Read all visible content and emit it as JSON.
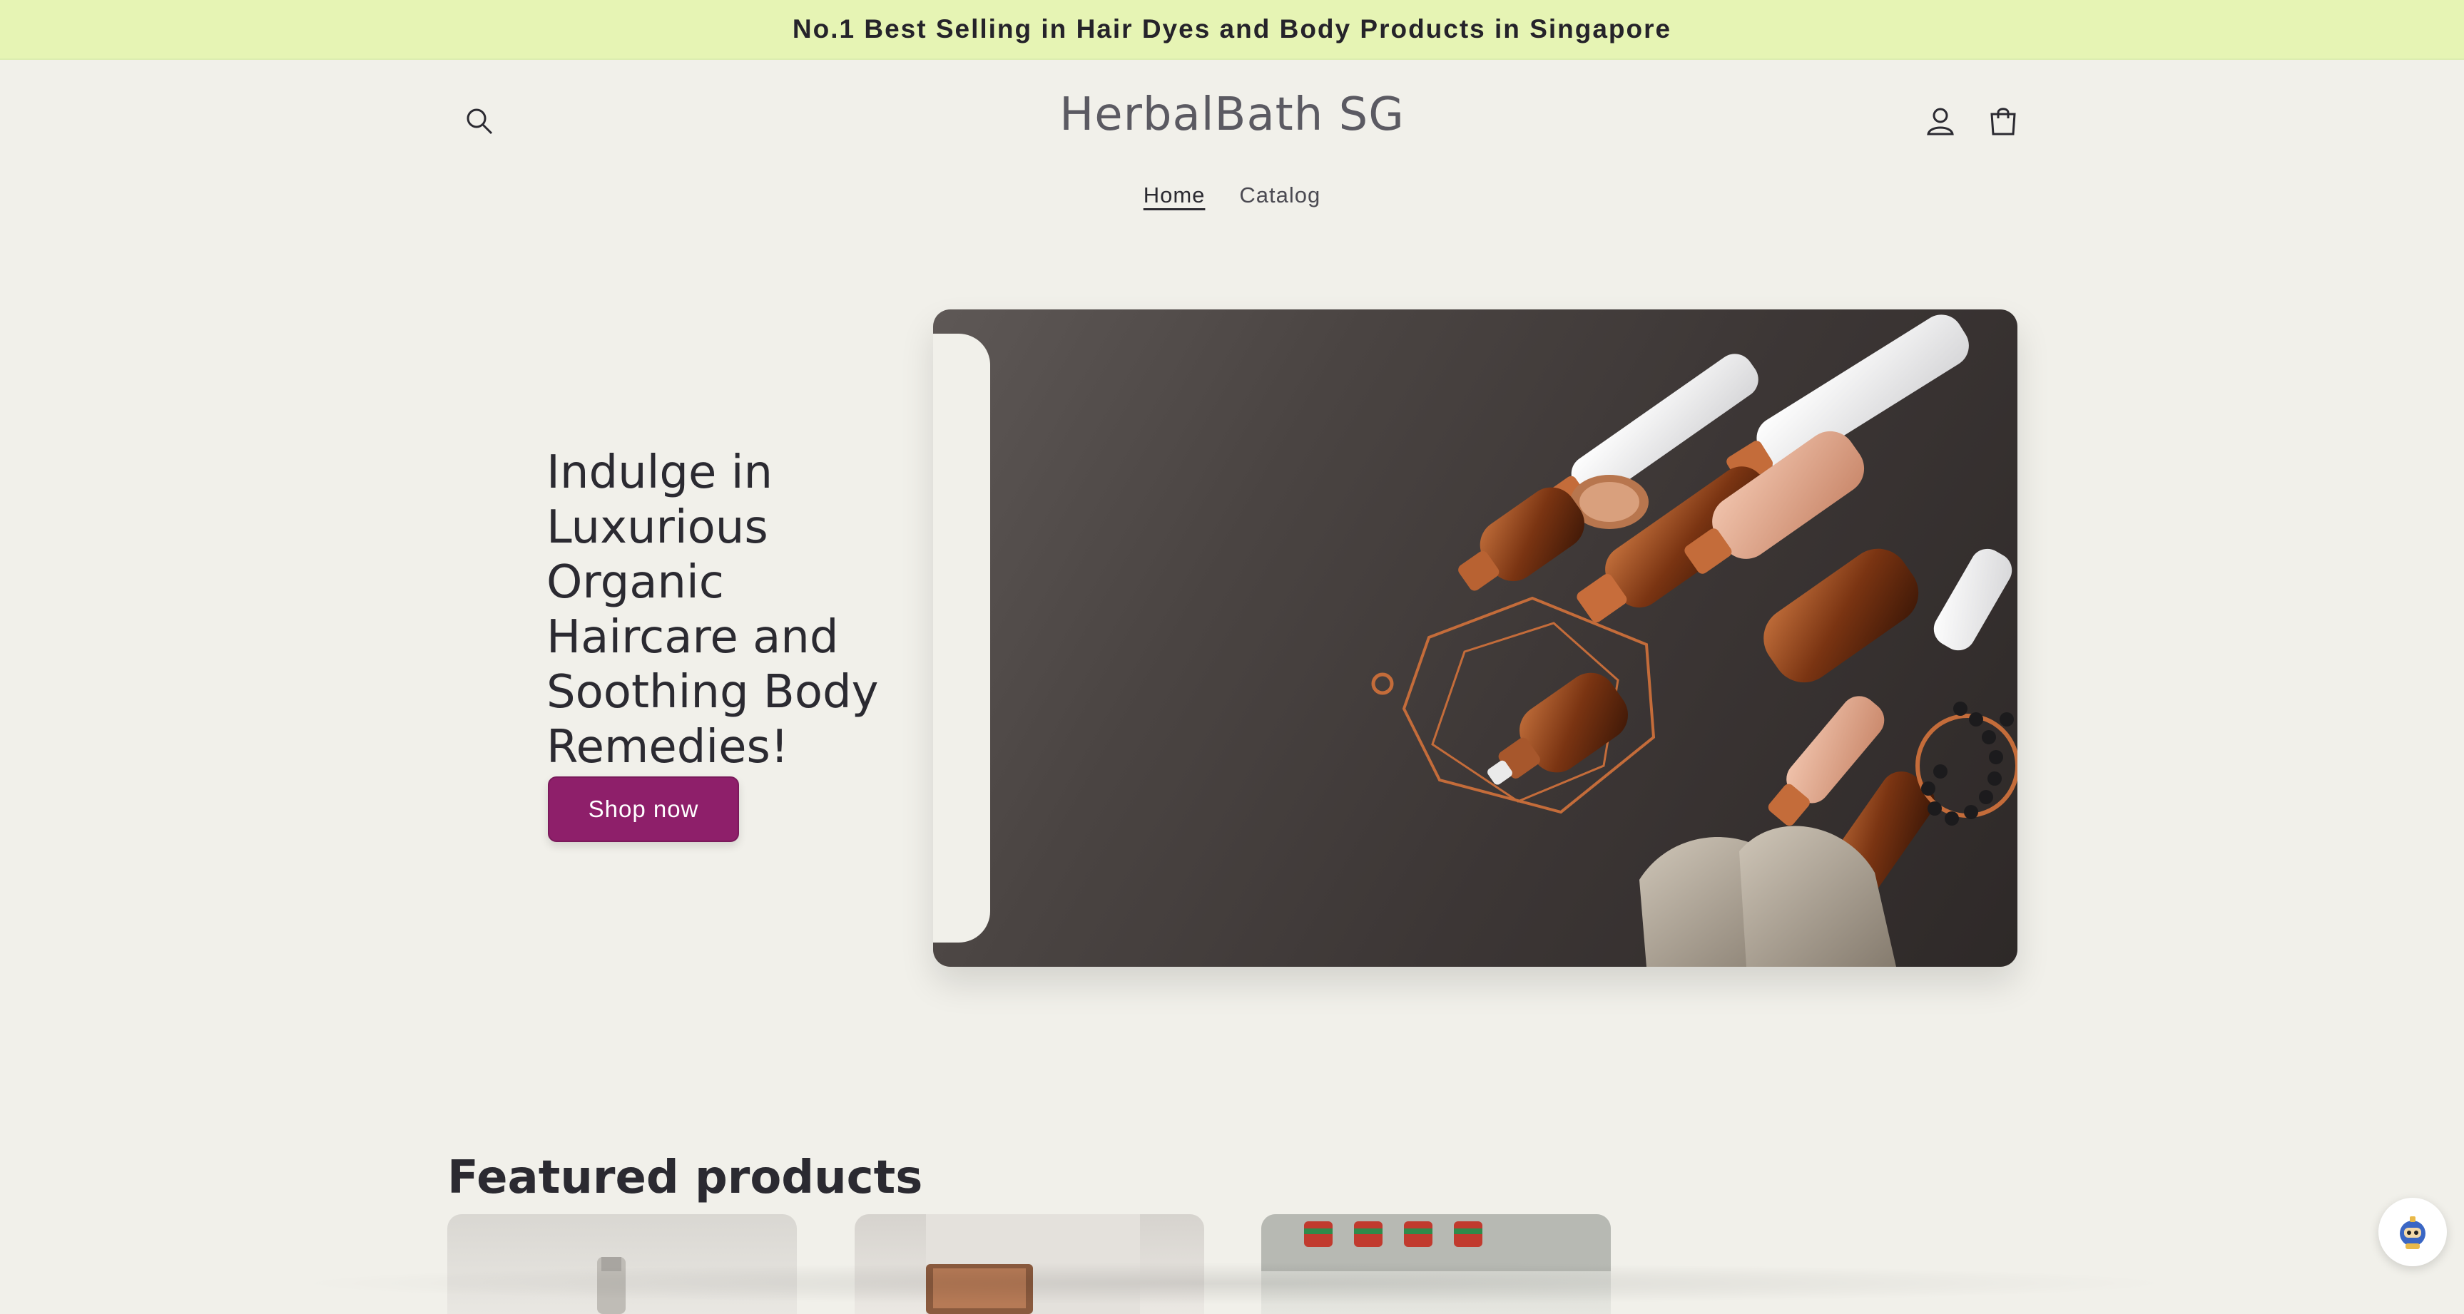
{
  "announcement": {
    "text": "No.1 Best Selling in Hair Dyes and Body Products in Singapore"
  },
  "header": {
    "logo": "HerbalBath SG",
    "icons": {
      "search": "search-icon",
      "account": "account-icon",
      "cart": "cart-icon"
    }
  },
  "nav": {
    "items": [
      {
        "label": "Home",
        "active": true
      },
      {
        "label": "Catalog",
        "active": false
      }
    ]
  },
  "hero": {
    "heading_lines": [
      "Indulge in",
      "Luxurious",
      "Organic",
      "Haircare and",
      "Soothing Body",
      "Remedies!"
    ],
    "button_label": "Shop now",
    "image": "cosmetic-bottles-photo"
  },
  "featured": {
    "title": "Featured products",
    "product_count_visible": 3
  },
  "chat": {
    "icon": "chat-bot-icon"
  },
  "colors": {
    "announcement_bg": "#e6f4b4",
    "page_bg": "#f1f0ea",
    "button_bg": "#8e1f6a",
    "text": "#2b2a31"
  }
}
